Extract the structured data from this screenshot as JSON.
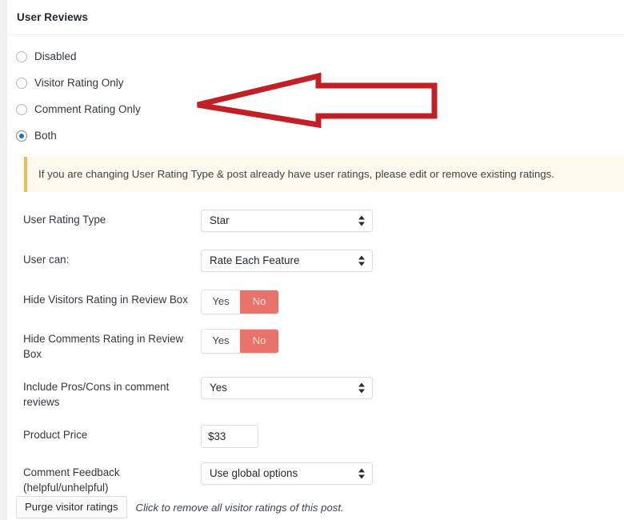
{
  "header": {
    "title": "User Reviews"
  },
  "review_mode": {
    "options": [
      {
        "label": "Disabled",
        "selected": false
      },
      {
        "label": "Visitor Rating Only",
        "selected": false
      },
      {
        "label": "Comment Rating Only",
        "selected": false
      },
      {
        "label": "Both",
        "selected": true
      }
    ]
  },
  "notice": {
    "text": "If you are changing User Rating Type & post already have user ratings, please edit or remove existing ratings.",
    "accent_color": "#e5bf5b",
    "background_color": "#fdf9ee"
  },
  "fields": [
    {
      "name": "user-rating-type",
      "label": "User Rating Type",
      "control": "select",
      "value": "Star"
    },
    {
      "name": "user-can",
      "label": "User can:",
      "control": "select",
      "value": "Rate Each Feature"
    },
    {
      "name": "hide-visitors-rating",
      "label": "Hide Visitors Rating in Review Box",
      "control": "toggle",
      "options": [
        "Yes",
        "No"
      ],
      "value": "No"
    },
    {
      "name": "hide-comments-rating",
      "label": "Hide Comments Rating in Review Box",
      "control": "toggle",
      "options": [
        "Yes",
        "No"
      ],
      "value": "No"
    },
    {
      "name": "include-pros-cons",
      "label": "Include Pros/Cons in comment reviews",
      "control": "select",
      "value": "Yes"
    },
    {
      "name": "product-price",
      "label": "Product Price",
      "control": "text",
      "value": "$33",
      "placeholder": ""
    },
    {
      "name": "comment-feedback",
      "label": "Comment Feedback (helpful/unhelpful)",
      "control": "select",
      "value": "Use global options"
    }
  ],
  "purge": {
    "button_label": "Purge visitor ratings",
    "hint": "Click to remove all visitor ratings of this post."
  },
  "annotation": {
    "type": "arrow-left",
    "color": "#c32026",
    "points_at": "Comment Rating Only"
  },
  "toggle_active_color": "#e8736a"
}
